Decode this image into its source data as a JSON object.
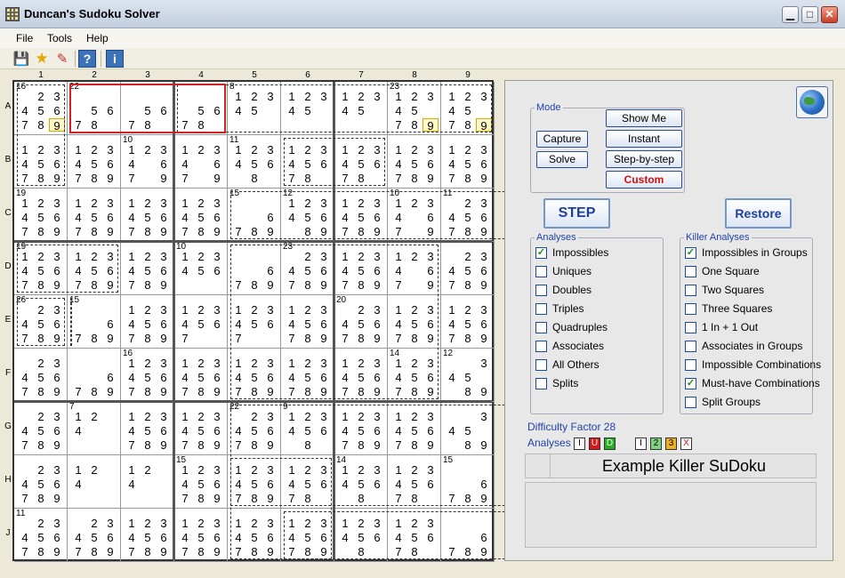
{
  "window": {
    "title": "Duncan's Sudoku Solver"
  },
  "menu": [
    "File",
    "Tools",
    "Help"
  ],
  "toolbar": {
    "buttons": [
      {
        "name": "save-icon",
        "glyph": "💾"
      },
      {
        "name": "star-icon",
        "glyph": "★"
      },
      {
        "name": "edit-icon",
        "glyph": "✎"
      },
      {
        "name": "help-icon",
        "glyph": "?"
      },
      {
        "name": "info-icon",
        "glyph": "i"
      }
    ]
  },
  "columns": [
    "1",
    "2",
    "3",
    "4",
    "5",
    "6",
    "7",
    "8",
    "9"
  ],
  "rows": [
    "A",
    "B",
    "C",
    "D",
    "E",
    "F",
    "G",
    "H",
    "J"
  ],
  "cells": [
    [
      {
        "k": "16",
        "c": "23456789"
      },
      {
        "k": "22",
        "c": "5678"
      },
      {
        "k": "",
        "c": "5678"
      },
      {
        "k": "",
        "c": "5678"
      },
      {
        "k": "8",
        "c": "12345"
      },
      {
        "k": "",
        "c": "12345"
      },
      {
        "k": "",
        "c": "12345"
      },
      {
        "k": "23",
        "c": "12345789"
      },
      {
        "k": "",
        "c": "12345789"
      }
    ],
    [
      {
        "k": "",
        "c": "123456789"
      },
      {
        "k": "",
        "c": "123456789"
      },
      {
        "k": "10",
        "c": "1234679"
      },
      {
        "k": "",
        "c": "1234679"
      },
      {
        "k": "11",
        "c": "1234568"
      },
      {
        "k": "",
        "c": "12345678"
      },
      {
        "k": "",
        "c": "12345678"
      },
      {
        "k": "",
        "c": "123456789"
      },
      {
        "k": "",
        "c": "123456789"
      }
    ],
    [
      {
        "k": "19",
        "c": "123456789"
      },
      {
        "k": "",
        "c": "123456789"
      },
      {
        "k": "",
        "c": "123456789"
      },
      {
        "k": "",
        "c": "123456789"
      },
      {
        "k": "15",
        "c": "6789"
      },
      {
        "k": "12",
        "c": "12345689"
      },
      {
        "k": "",
        "c": "123456789"
      },
      {
        "k": "10",
        "c": "1234679"
      },
      {
        "k": "11",
        "c": "23456789"
      }
    ],
    [
      {
        "k": "19",
        "c": "123456789"
      },
      {
        "k": "",
        "c": "123456789"
      },
      {
        "k": "",
        "c": "123456789"
      },
      {
        "k": "10",
        "c": "123456"
      },
      {
        "k": "",
        "c": "6789"
      },
      {
        "k": "23",
        "c": "23456789"
      },
      {
        "k": "",
        "c": "123456789"
      },
      {
        "k": "",
        "c": "1234679"
      },
      {
        "k": "",
        "c": "23456789"
      }
    ],
    [
      {
        "k": "26",
        "c": "23456789"
      },
      {
        "k": "15",
        "c": "6789"
      },
      {
        "k": "",
        "c": "123456789"
      },
      {
        "k": "",
        "c": "1234567"
      },
      {
        "k": "",
        "c": "1234567"
      },
      {
        "k": "",
        "c": "123456789"
      },
      {
        "k": "20",
        "c": "23456789"
      },
      {
        "k": "",
        "c": "123456789"
      },
      {
        "k": "",
        "c": "123456789"
      }
    ],
    [
      {
        "k": "",
        "c": "23456789"
      },
      {
        "k": "",
        "c": "6789"
      },
      {
        "k": "16",
        "c": "123456789"
      },
      {
        "k": "",
        "c": "123456789"
      },
      {
        "k": "",
        "c": "123456789"
      },
      {
        "k": "",
        "c": "123456789"
      },
      {
        "k": "",
        "c": "123456789"
      },
      {
        "k": "14",
        "c": "123456789"
      },
      {
        "k": "12",
        "c": "34589"
      }
    ],
    [
      {
        "k": "",
        "c": "23456789"
      },
      {
        "k": "7",
        "c": "124"
      },
      {
        "k": "",
        "c": "123456789"
      },
      {
        "k": "",
        "c": "123456789"
      },
      {
        "k": "22",
        "c": "23456789"
      },
      {
        "k": "9",
        "c": "1234568"
      },
      {
        "k": "",
        "c": "123456789"
      },
      {
        "k": "",
        "c": "123456789"
      },
      {
        "k": "",
        "c": "34589"
      }
    ],
    [
      {
        "k": "",
        "c": "23456789"
      },
      {
        "k": "",
        "c": "124"
      },
      {
        "k": "",
        "c": "124"
      },
      {
        "k": "15",
        "c": "123456789"
      },
      {
        "k": "",
        "c": "123456789"
      },
      {
        "k": "",
        "c": "12345678"
      },
      {
        "k": "14",
        "c": "1234568"
      },
      {
        "k": "",
        "c": "12345678"
      },
      {
        "k": "15",
        "c": "6789"
      }
    ],
    [
      {
        "k": "11",
        "c": "23456789"
      },
      {
        "k": "",
        "c": "23456789"
      },
      {
        "k": "",
        "c": "123456789"
      },
      {
        "k": "",
        "c": "123456789"
      },
      {
        "k": "",
        "c": "123456789"
      },
      {
        "k": "",
        "c": "123456789"
      },
      {
        "k": "",
        "c": "1234568"
      },
      {
        "k": "",
        "c": "12345678"
      },
      {
        "k": "",
        "c": "6789"
      }
    ]
  ],
  "highlights": [
    {
      "r": 0,
      "c": 0,
      "d": "9",
      "t": "hl"
    },
    {
      "r": 0,
      "c": 1,
      "d": "9",
      "t": "hl2"
    },
    {
      "r": 0,
      "c": 2,
      "d": "9",
      "t": "hl2"
    },
    {
      "r": 0,
      "c": 7,
      "d": "9",
      "t": "hl"
    },
    {
      "r": 0,
      "c": 8,
      "d": "9",
      "t": "hl"
    }
  ],
  "mode": {
    "legend": "Mode",
    "capture": "Capture",
    "solve": "Solve",
    "show_me": "Show Me",
    "instant": "Instant",
    "step_by_step": "Step-by-step",
    "custom": "Custom"
  },
  "step": "STEP",
  "restore": "Restore",
  "analyses": {
    "legend": "Analyses",
    "items": [
      {
        "label": "Impossibles",
        "checked": true
      },
      {
        "label": "Uniques",
        "checked": false
      },
      {
        "label": "Doubles",
        "checked": false
      },
      {
        "label": "Triples",
        "checked": false
      },
      {
        "label": "Quadruples",
        "checked": false
      },
      {
        "label": "Associates",
        "checked": false
      },
      {
        "label": "All Others",
        "checked": false
      },
      {
        "label": "Splits",
        "checked": false
      }
    ]
  },
  "killer": {
    "legend": "Killer Analyses",
    "items": [
      {
        "label": "Impossibles in Groups",
        "checked": true
      },
      {
        "label": "One Square",
        "checked": false
      },
      {
        "label": "Two Squares",
        "checked": false
      },
      {
        "label": "Three Squares",
        "checked": false
      },
      {
        "label": "1 In + 1 Out",
        "checked": false
      },
      {
        "label": "Associates in Groups",
        "checked": false
      },
      {
        "label": "Impossible Combinations",
        "checked": false
      },
      {
        "label": "Must-have Combinations",
        "checked": true
      },
      {
        "label": "Split Groups",
        "checked": false
      }
    ]
  },
  "difficulty": "Difficulty Factor 28",
  "analyses_label": "Analyses",
  "badges": [
    {
      "t": "I",
      "bg": "#ffffff",
      "fg": "#000000"
    },
    {
      "t": "U",
      "bg": "#d81818",
      "fg": "#ffffff"
    },
    {
      "t": "D",
      "bg": "#22b022",
      "fg": "#ffffff"
    },
    {
      "t": "I",
      "bg": "#ffffff",
      "fg": "#000000"
    },
    {
      "t": "2",
      "bg": "#7fd07f",
      "fg": "#000000"
    },
    {
      "t": "3",
      "bg": "#f0b020",
      "fg": "#000000"
    },
    {
      "t": "X",
      "bg": "#ffffff",
      "fg": "#d01010"
    }
  ],
  "puzzle_name": "Example Killer SuDoku"
}
